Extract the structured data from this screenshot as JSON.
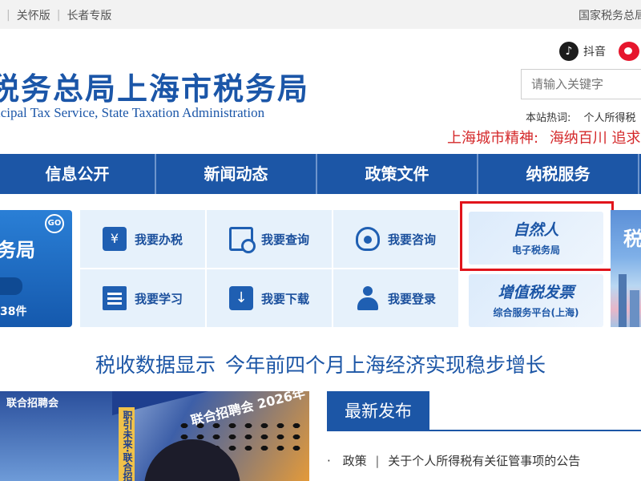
{
  "topbar": {
    "links": [
      "关怀版",
      "长者专版"
    ],
    "right_link": "国家税务总局"
  },
  "header": {
    "title": "税务总局上海市税务局",
    "subtitle": "icipal Tax Service, State Taxation Administration",
    "social": [
      {
        "name": "抖音",
        "icon": "tiktok-icon"
      },
      {
        "name": "",
        "icon": "weibo-icon"
      }
    ],
    "search_placeholder": "请输入关键字",
    "hot_label": "本站热词:",
    "hot_words": [
      "个人所得税"
    ],
    "spirit_label": "上海城市精神:",
    "spirit_text": "海纳百川 追求"
  },
  "nav": {
    "items": [
      "信息公开",
      "新闻动态",
      "政策文件",
      "纳税服务"
    ]
  },
  "promo": {
    "title": "务局",
    "badge": "GO",
    "count": "38件"
  },
  "services": [
    {
      "label": "我要办税",
      "icon": "tax-handling-icon"
    },
    {
      "label": "我要查询",
      "icon": "query-icon"
    },
    {
      "label": "我要咨询",
      "icon": "consult-headset-icon"
    },
    {
      "label": "我要学习",
      "icon": "learn-book-icon"
    },
    {
      "label": "我要下载",
      "icon": "download-icon"
    },
    {
      "label": "我要登录",
      "icon": "login-user-icon"
    }
  ],
  "cards": {
    "etax": {
      "title": "自然人",
      "subtitle": "电子税务局"
    },
    "vat": {
      "title": "增值税发票",
      "subtitle": "综合服务平台(上海)"
    }
  },
  "side_image": {
    "char": "税"
  },
  "headline": {
    "parts": [
      "税收数据显示",
      "今年前四个月上海经济实现稳步增长"
    ]
  },
  "photo": {
    "banner_text": "联合招聘会 2026年",
    "board_text": "联合招聘会",
    "column_text": "职引未来·联合招聘会"
  },
  "latest": {
    "tab_label": "最新发布",
    "items": [
      {
        "category": "政策",
        "title": "关于个人所得税有关征管事项的公告"
      }
    ]
  },
  "colors": {
    "brand_blue": "#1c56a6",
    "highlight_red": "#e1141b",
    "spirit_red": "#d4282a"
  }
}
